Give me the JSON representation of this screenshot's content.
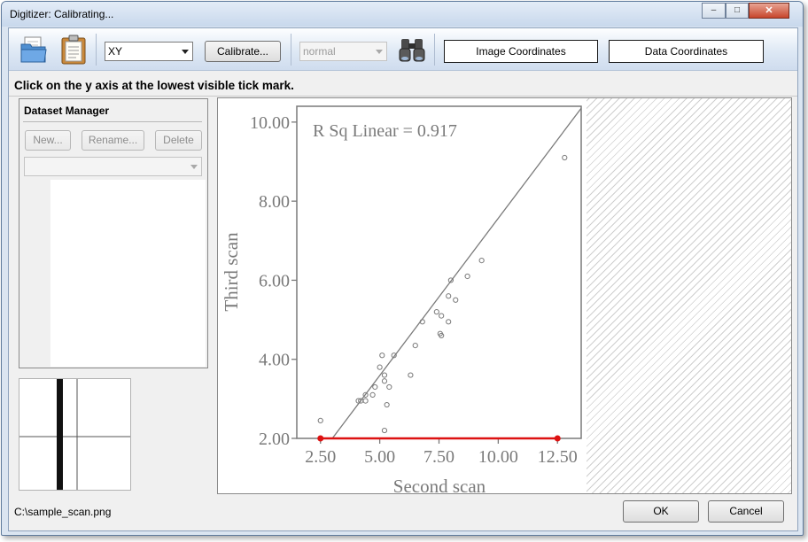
{
  "window": {
    "title": "Digitizer: Calibrating...",
    "controls": {
      "minimize": "–",
      "maximize": "□",
      "close": "✕"
    }
  },
  "toolbar": {
    "open_icon": "folder-icon",
    "paste_icon": "clipboard-icon",
    "zoom_icon": "binoculars-icon",
    "mode_select": "XY",
    "calibrate_label": "Calibrate...",
    "scale_select": "normal",
    "image_coords_label": "Image Coordinates",
    "data_coords_label": "Data Coordinates"
  },
  "instruction": "Click on the y axis at the lowest visible tick mark.",
  "dataset_manager": {
    "title": "Dataset Manager",
    "new_label": "New...",
    "rename_label": "Rename...",
    "delete_label": "Delete",
    "selected_dataset": ""
  },
  "colors": {
    "calibration_marker": "#dd1111",
    "plot_gray": "#7a7a7a"
  },
  "chart_data": {
    "type": "scatter",
    "annotation": "R Sq Linear = 0.917",
    "xlabel": "Second scan",
    "ylabel": "Third scan",
    "xlim": [
      1.5,
      13.5
    ],
    "ylim": [
      2.0,
      10.4
    ],
    "x_ticks": [
      "2.50",
      "5.00",
      "7.50",
      "10.00",
      "12.50"
    ],
    "y_ticks": [
      "2.00",
      "4.00",
      "6.00",
      "8.00",
      "10.00"
    ],
    "points": [
      [
        12.8,
        9.1
      ],
      [
        9.3,
        6.5
      ],
      [
        8.7,
        6.1
      ],
      [
        8.0,
        6.0
      ],
      [
        7.9,
        5.6
      ],
      [
        8.2,
        5.5
      ],
      [
        7.4,
        5.2
      ],
      [
        7.6,
        5.1
      ],
      [
        6.8,
        4.95
      ],
      [
        7.9,
        4.95
      ],
      [
        7.6,
        4.6
      ],
      [
        7.55,
        4.65
      ],
      [
        6.5,
        4.35
      ],
      [
        5.6,
        4.1
      ],
      [
        5.1,
        4.1
      ],
      [
        5.0,
        3.8
      ],
      [
        5.2,
        3.6
      ],
      [
        6.3,
        3.6
      ],
      [
        5.2,
        3.45
      ],
      [
        5.4,
        3.3
      ],
      [
        4.8,
        3.3
      ],
      [
        4.4,
        3.1
      ],
      [
        4.7,
        3.1
      ],
      [
        4.2,
        2.95
      ],
      [
        4.4,
        2.95
      ],
      [
        4.1,
        2.95
      ],
      [
        5.3,
        2.85
      ],
      [
        2.5,
        2.45
      ],
      [
        5.2,
        2.2
      ]
    ],
    "fit_line": {
      "x": [
        3.0,
        13.5
      ],
      "y": [
        2.0,
        10.35
      ]
    },
    "calibration_points": [
      [
        2.5,
        2.0
      ],
      [
        12.5,
        2.0
      ]
    ],
    "grid": false
  },
  "status": {
    "file_path": "C:\\sample_scan.png",
    "ok_label": "OK",
    "cancel_label": "Cancel"
  }
}
